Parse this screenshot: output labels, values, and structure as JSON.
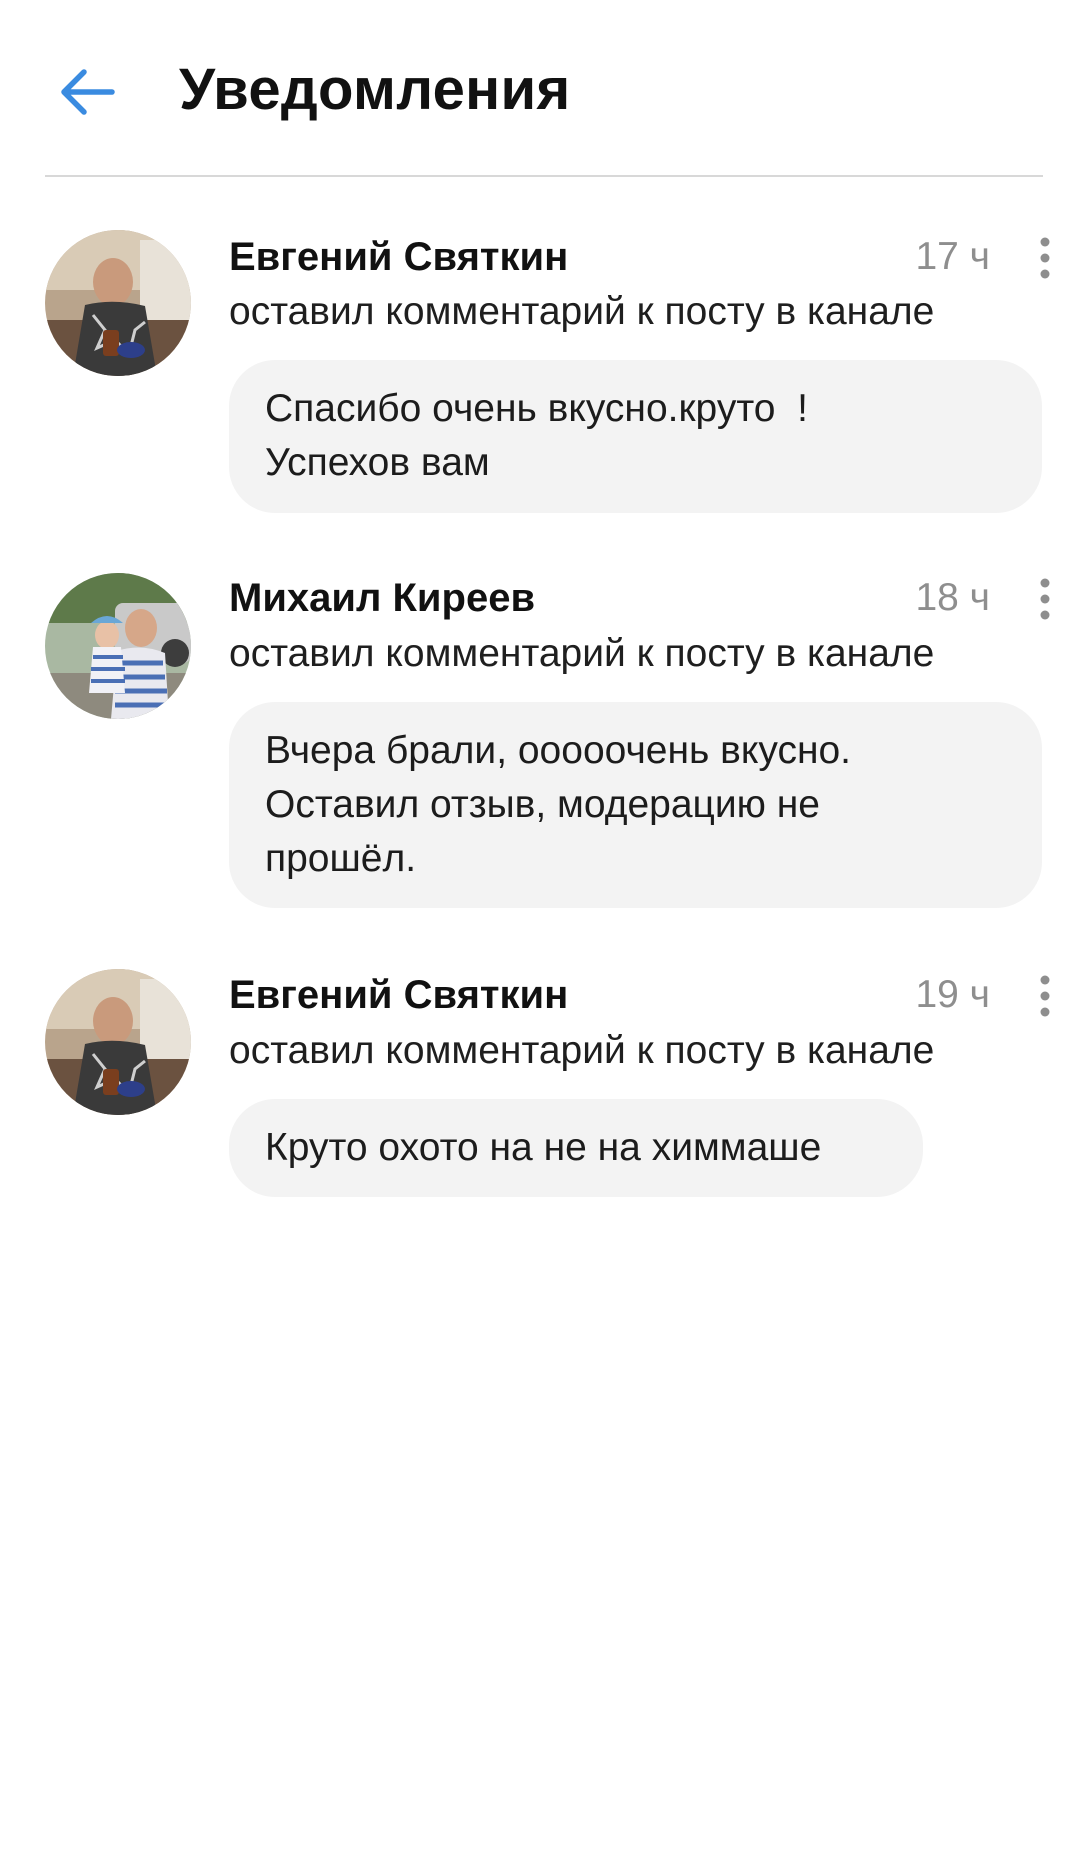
{
  "header": {
    "title": "Уведомления",
    "back_icon": "arrow-left-icon",
    "accent_color": "#3a8be0"
  },
  "notifications": [
    {
      "author": "Евгений Святкин",
      "time": "17 ч",
      "action": "оставил комментарий к посту в канале",
      "comment": "Спасибо очень вкусно.круто  !\nУспехов вам",
      "avatar_icon": "user-photo-avatar"
    },
    {
      "author": "Михаил Киреев",
      "time": "18 ч",
      "action": "оставил комментарий к посту в канале",
      "comment": "Вчера брали, ооооочень вкусно.\nОставил отзыв, модерацию не\nпрошёл.",
      "avatar_icon": "user-photo-avatar"
    },
    {
      "author": "Евгений Святкин",
      "time": "19 ч",
      "action": "оставил комментарий к посту в канале",
      "comment": "Круто охото на не на химмаше",
      "avatar_icon": "user-photo-avatar"
    }
  ]
}
